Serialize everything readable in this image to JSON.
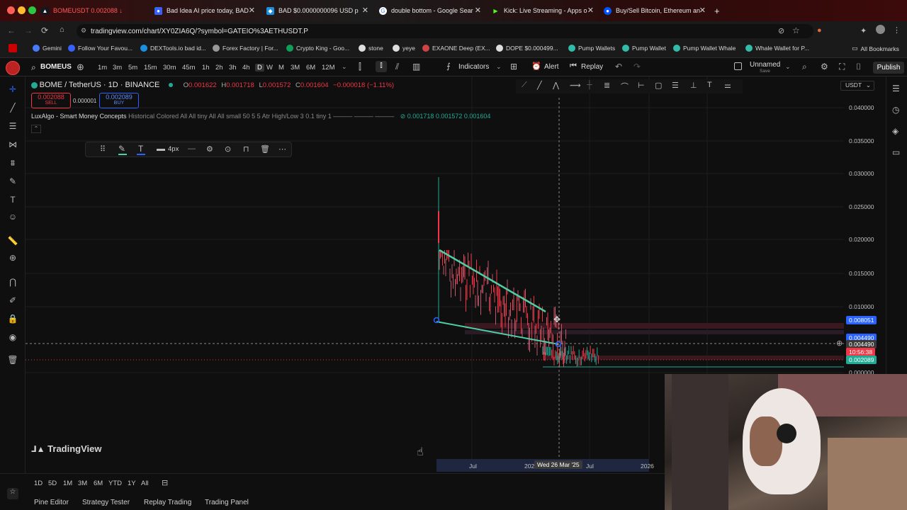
{
  "browser": {
    "tabs": [
      {
        "title": "BOMEUSDT 0.002088 ↓",
        "active": true
      },
      {
        "title": "Bad Idea AI price today, BAD"
      },
      {
        "title": "BAD $0.0000000096 USD p"
      },
      {
        "title": "double bottom - Google Sear"
      },
      {
        "title": "Kick: Live Streaming - Apps o"
      },
      {
        "title": "Buy/Sell Bitcoin, Ethereum an"
      }
    ],
    "new_tab": "+",
    "url": "tradingview.com/chart/XY0ZIA6Q/?symbol=GATEIO%3AETHUSDT.P",
    "bookmarks": [
      "Gemini",
      "Follow Your Favou...",
      "DEXTools.io bad id...",
      "Forex Factory | For...",
      "Crypto King - Goo...",
      "stone",
      "yeye",
      "EXAONE Deep (EX...",
      "DOPE $0.000499...",
      "Pump Wallets",
      "Pump Wallet",
      "Pump Wallet Whale",
      "Whale Wallet for P..."
    ],
    "all_bookmarks": "All Bookmarks"
  },
  "toolbar": {
    "symbol": "BOMEUS",
    "timeframes": [
      "1m",
      "3m",
      "5m",
      "15m",
      "30m",
      "45m",
      "1h",
      "2h",
      "3h",
      "4h",
      "D",
      "W",
      "M",
      "3M",
      "6M",
      "12M"
    ],
    "indicators": "Indicators",
    "alert": "Alert",
    "replay": "Replay",
    "layout_name": "Unnamed",
    "layout_sub": "Save",
    "publish": "Publish"
  },
  "legend": {
    "title": "BOME / TetherUS · 1D · BINANCE",
    "o_label": "O",
    "o": "0.001622",
    "h_label": "H",
    "h": "0.001718",
    "l_label": "L",
    "l": "0.001572",
    "c_label": "C",
    "c": "0.001604",
    "change": "−0.000018 (−1.11%)",
    "sell_price": "0.002088",
    "sell": "SELL",
    "spread": "0.000001",
    "buy_price": "0.002089",
    "buy": "BUY",
    "indicator_name": "LuxAlgo - Smart Money Concepts",
    "indicator_params": "Historical Colored All All tiny All All small 50 5 5 Atr High/Low 3 0.1 tiny 1 ——— ——— ———",
    "indicator_values": "0.001718  0.001572  0.001604"
  },
  "drawing_toolbar": {
    "width_label": "4px"
  },
  "price_axis": {
    "currency": "USDT",
    "ticks": [
      "0.040000",
      "0.035000",
      "0.030000",
      "0.025000",
      "0.020000",
      "0.015000",
      "0.010000",
      "0.000000"
    ],
    "tags": [
      {
        "value": "0.008051",
        "color": "#2962ff"
      },
      {
        "value": "0.004490",
        "color": "#2962ff"
      },
      {
        "value": "0.004490",
        "color": "#3a3a3a"
      },
      {
        "value": "10:56:38",
        "color": "#f23645"
      },
      {
        "value": "0.002089",
        "color": "#22ab94"
      }
    ]
  },
  "time_axis": {
    "ticks": [
      "Jul",
      "202",
      "Jul",
      "2026"
    ],
    "crosshair_date": "Wed 26 Mar '25"
  },
  "watermark": "TradingView",
  "date_ranges": [
    "1D",
    "5D",
    "1M",
    "3M",
    "6M",
    "YTD",
    "1Y",
    "All"
  ],
  "panels": [
    "Pine Editor",
    "Strategy Tester",
    "Replay Trading",
    "Trading Panel"
  ],
  "colors": {
    "accent": "#2962ff",
    "up": "#22ab94",
    "down": "#f23645",
    "trendline": "#4ecfa5"
  }
}
